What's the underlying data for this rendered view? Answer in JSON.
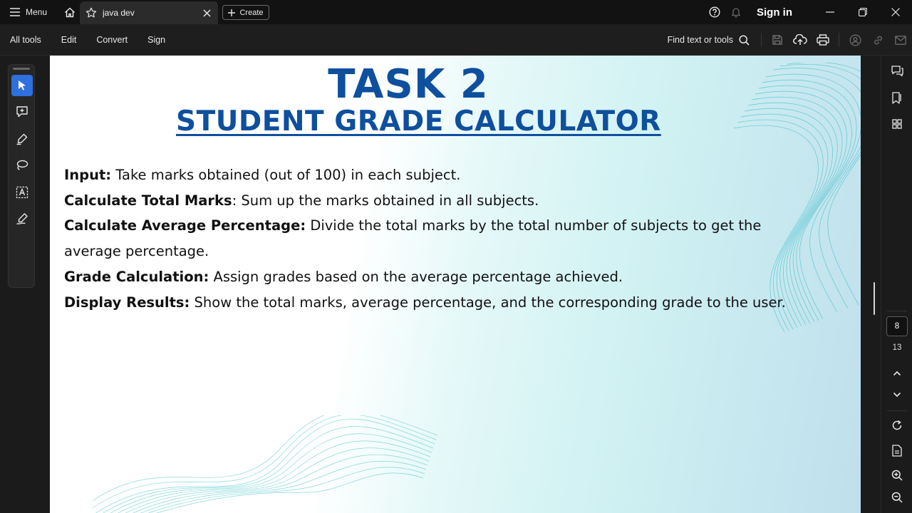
{
  "titlebar": {
    "menu_label": "Menu",
    "tab_label": "java dev",
    "create_label": "Create",
    "signin_label": "Sign in"
  },
  "toolbar": {
    "menus": [
      "All tools",
      "Edit",
      "Convert",
      "Sign"
    ],
    "find_label": "Find text or tools"
  },
  "document": {
    "title": "TASK 2",
    "subtitle": "STUDENT GRADE CALCULATOR",
    "items": [
      {
        "label": "Input:",
        "text": " Take marks obtained (out of 100) in each subject."
      },
      {
        "label": "Calculate Total Marks",
        "text": ": Sum up the marks obtained in all subjects."
      },
      {
        "label": "Calculate Average Percentage:",
        "text": " Divide the total marks by the total number of subjects to get the"
      },
      {
        "label": "",
        "text": "average percentage."
      },
      {
        "label": "Grade Calculation:",
        "text": " Assign grades based on the average percentage achieved."
      },
      {
        "label": "Display Results:",
        "text": " Show the total marks, average percentage, and the corresponding grade to the user."
      }
    ]
  },
  "navigation": {
    "current_page": "8",
    "total_pages": "13"
  },
  "colors": {
    "accent": "#2f6fde",
    "doc_title": "#0e4f9e"
  },
  "icons": {
    "left_rail": [
      "cursor-icon",
      "add-comment-icon",
      "highlight-pen-icon",
      "lasso-icon",
      "text-recognize-icon",
      "fill-sign-icon"
    ],
    "right_panel": [
      "comments-icon",
      "bookmarks-icon",
      "thumbnails-icon",
      "scroll-up-icon",
      "scroll-down-icon",
      "rotate-icon",
      "page-properties-icon",
      "zoom-in-icon",
      "zoom-out-icon"
    ]
  }
}
